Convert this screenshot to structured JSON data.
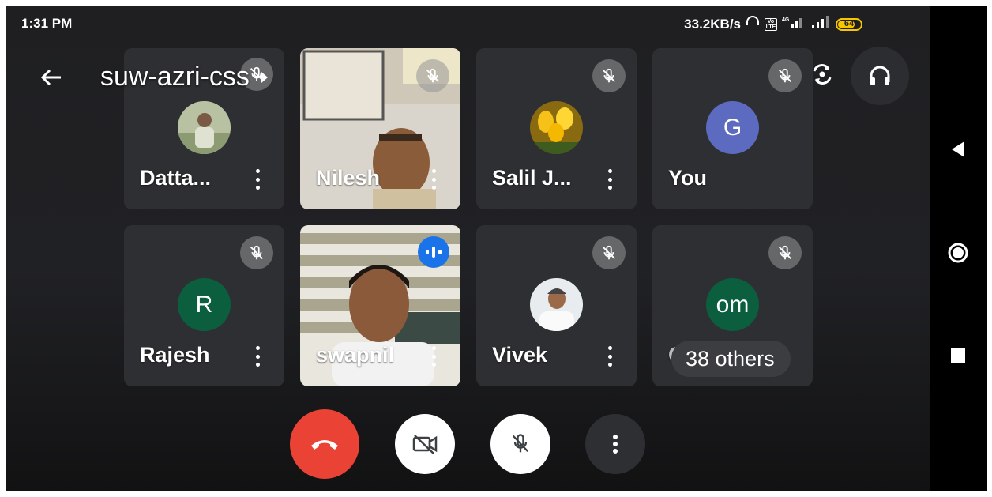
{
  "status_bar": {
    "time": "1:31 PM",
    "net_speed": "33.2KB/s",
    "battery_level": "64"
  },
  "header": {
    "meeting_code": "suw-azri-css"
  },
  "participants": [
    {
      "name": "Datta...",
      "muted": true,
      "tile": "avatar-photo"
    },
    {
      "name": "Nilesh",
      "muted": true,
      "tile": "video"
    },
    {
      "name": "Salil J...",
      "muted": true,
      "tile": "avatar-photo"
    },
    {
      "name": "You",
      "muted": true,
      "tile": "avatar-initial",
      "initial": "G",
      "color": "#5c6bc0"
    },
    {
      "name": "Rajesh",
      "muted": true,
      "tile": "avatar-initial",
      "initial": "R",
      "color": "#0b5f3f"
    },
    {
      "name": "swapnil",
      "muted": false,
      "speaking": true,
      "tile": "video"
    },
    {
      "name": "Vivek",
      "muted": true,
      "tile": "avatar-photo"
    },
    {
      "name": "om",
      "muted": true,
      "tile": "avatar-initial",
      "initial": "om",
      "color": "#0b5f3f"
    }
  ],
  "others": {
    "partial_label": "ON",
    "chip_label": "38 others"
  },
  "colors": {
    "end_call": "#ea4335",
    "speaking_badge": "#1a73e8",
    "tile_bg": "#2e2f32"
  }
}
